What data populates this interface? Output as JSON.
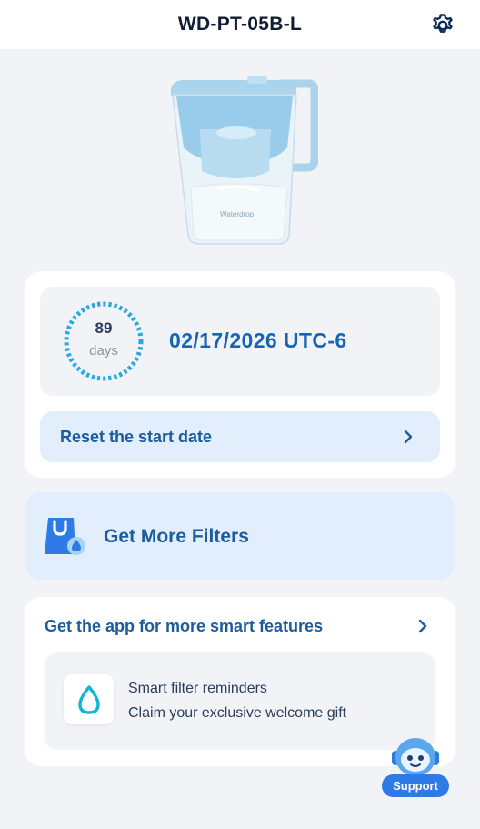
{
  "header": {
    "title": "WD-PT-05B-L",
    "settings_icon": "gear-icon"
  },
  "product_image": {
    "brand_text": "Waterdrop"
  },
  "filter_status": {
    "days_remaining": "89",
    "days_unit": "days",
    "expiry_date": "02/17/2026 UTC-6",
    "reset_label": "Reset the start date"
  },
  "shop": {
    "label": "Get More Filters",
    "icon": "shopping-bag-icon"
  },
  "app_promo": {
    "title": "Get the app for more smart features",
    "feature_1": "Smart filter reminders",
    "feature_2": "Claim your exclusive welcome gift",
    "icon": "water-drop-icon"
  },
  "support": {
    "label": "Support",
    "icon": "robot-mascot-icon"
  },
  "colors": {
    "primary_blue": "#1565b7",
    "button_bg": "#e2eefb",
    "ring_blue": "#29a8e0",
    "support_blue": "#2f7be6"
  }
}
